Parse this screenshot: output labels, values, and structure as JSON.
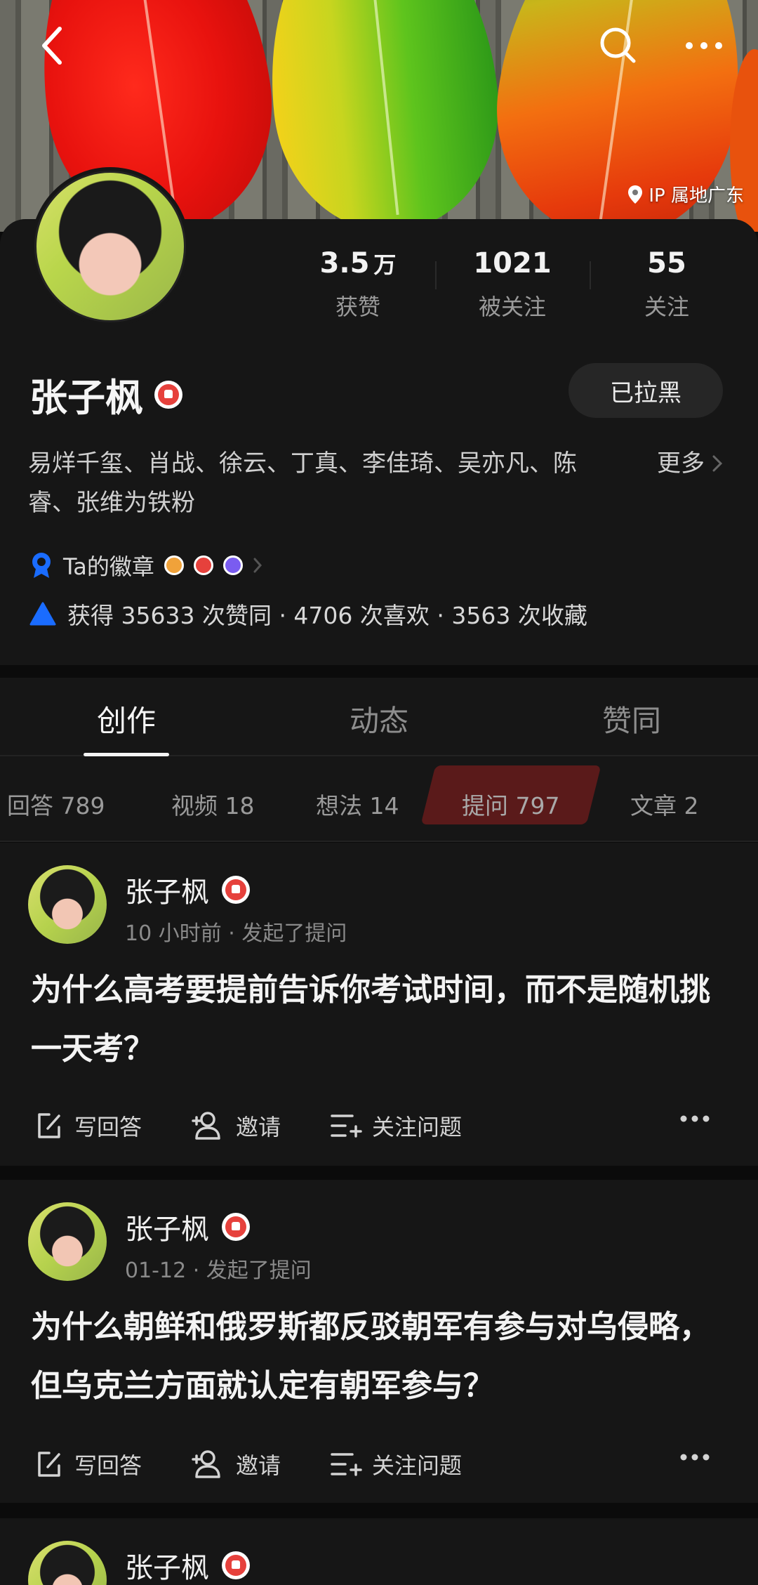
{
  "header": {
    "ip_location": "IP 属地广东"
  },
  "profile": {
    "stats": [
      {
        "value": "3.5",
        "unit": "万",
        "label": "获赞"
      },
      {
        "value": "1021",
        "unit": "",
        "label": "被关注"
      },
      {
        "value": "55",
        "unit": "",
        "label": "关注"
      }
    ],
    "name": "张子枫",
    "block_button": "已拉黑",
    "bio": "易烊千玺、肖战、徐云、丁真、李佳琦、吴亦凡、陈睿、张维为铁粉",
    "bio_more": "更多",
    "badges_label": "Ta的徽章",
    "achievements": "获得 35633 次赞同 · 4706 次喜欢 · 3563 次收藏"
  },
  "tabs": [
    "创作",
    "动态",
    "赞同"
  ],
  "subtabs": [
    "回答 789",
    "视频 18",
    "想法 14",
    "提问 797",
    "文章 2"
  ],
  "feed": [
    {
      "author": "张子枫",
      "meta": "10 小时前 · 发起了提问",
      "title": "为什么高考要提前告诉你考试时间，而不是随机挑一天考？"
    },
    {
      "author": "张子枫",
      "meta": "01-12 · 发起了提问",
      "title": "为什么朝鲜和俄罗斯都反驳朝军有参与对乌侵略，但乌克兰方面就认定有朝军参与？"
    },
    {
      "author": "张子枫"
    }
  ],
  "actions": {
    "write_answer": "写回答",
    "invite": "邀请",
    "follow_question": "关注问题"
  },
  "colors": {
    "background": "#0b0b0b",
    "card": "#161616",
    "badge_red": "#e6413c",
    "link_blue": "#1a6cff",
    "subtab_highlight": "#5a1a1a"
  }
}
